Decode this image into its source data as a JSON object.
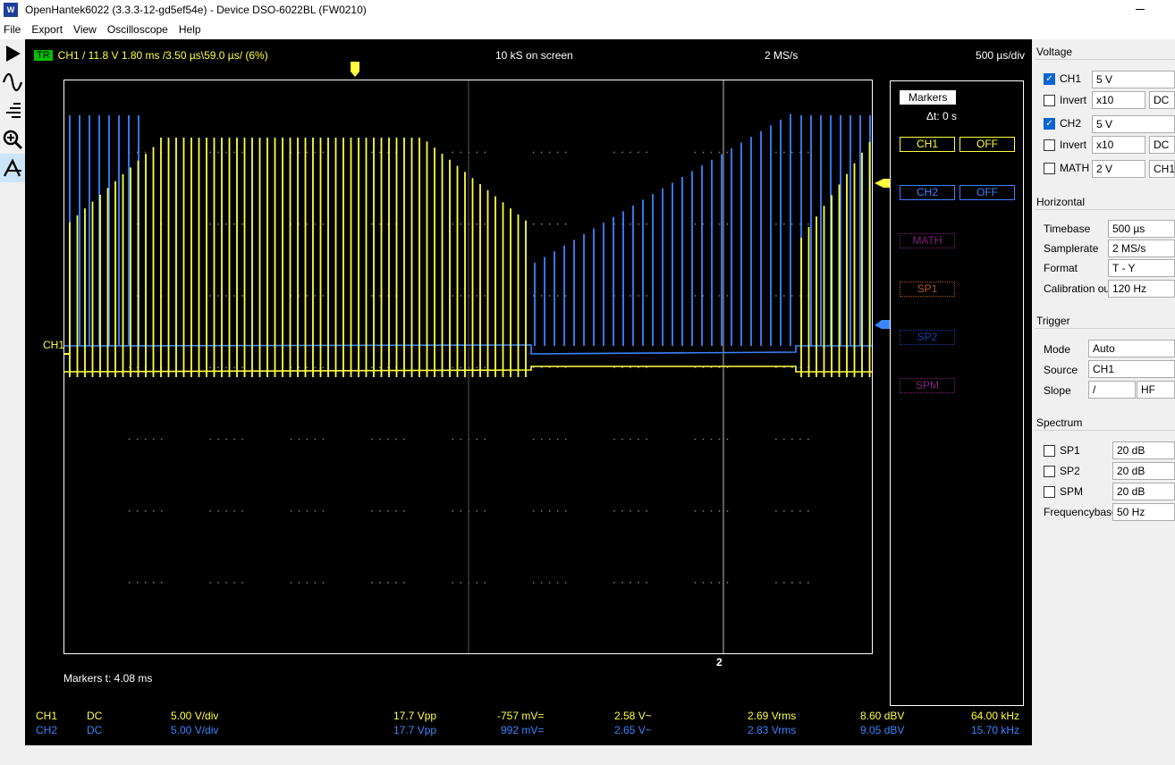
{
  "window": {
    "title": "OpenHantek6022 (3.3.3-12-gd5ef54e) - Device DSO-6022BL (FW0210)"
  },
  "menu": {
    "items": [
      "File",
      "Export",
      "View",
      "Oscilloscope",
      "Help"
    ]
  },
  "toolbar": {
    "icons": [
      "play-icon",
      "sine-icon",
      "histogram-icon",
      "zoom-icon",
      "cursor-measure-icon"
    ]
  },
  "scope": {
    "trigger_badge": "TR",
    "trigger_info": "CH1  /  11.8 V  1.80 ms  /3.50 µs\\59.0 µs/ (6%)",
    "samples_on_screen": "10 kS on screen",
    "samplerate": "2 MS/s",
    "timebase": "500 µs/div",
    "ch1_level_label": "CH1",
    "marker2_label": "2",
    "markers_readout": "Markers   t: 4.08 ms"
  },
  "markers_panel": {
    "title": "Markers",
    "delta_t": "Δt: 0 s",
    "buttons": [
      {
        "name": "CH1",
        "state": "OFF"
      },
      {
        "name": "CH2",
        "state": "OFF"
      },
      {
        "name": "MATH"
      },
      {
        "name": "SP1"
      },
      {
        "name": "SP2"
      },
      {
        "name": "SPM"
      }
    ]
  },
  "measurements": {
    "ch1": {
      "channel": "CH1",
      "coupling": "DC",
      "scale": "5.00 V/div",
      "vpp": "17.7 Vpp",
      "dc": "-757 mV=",
      "ac": "2.58 V~",
      "rms": "2.69 Vrms",
      "dbv": "8.60 dBV",
      "freq": "64.00 kHz"
    },
    "ch2": {
      "channel": "CH2",
      "coupling": "DC",
      "scale": "5.00 V/div",
      "vpp": "17.7 Vpp",
      "dc": "992 mV=",
      "ac": "2.65 V~",
      "rms": "2.83 Vrms",
      "dbv": "9.05 dBV",
      "freq": "15.70 kHz"
    }
  },
  "voltage": {
    "heading": "Voltage",
    "ch1": {
      "label": "CH1",
      "checked": true,
      "scale": "5 V",
      "invert_label": "Invert",
      "probe": "x10",
      "coupling": "DC"
    },
    "ch2": {
      "label": "CH2",
      "checked": true,
      "scale": "5 V",
      "invert_label": "Invert",
      "probe": "x10",
      "coupling": "DC"
    },
    "math": {
      "label": "MATH",
      "scale": "2 V",
      "mode": "CH1"
    }
  },
  "horizontal": {
    "heading": "Horizontal",
    "timebase_label": "Timebase",
    "timebase": "500 µs",
    "samplerate_label": "Samplerate",
    "samplerate": "2 MS/s",
    "format_label": "Format",
    "format": "T - Y",
    "calibration_label": "Calibration out",
    "calibration": "120 Hz"
  },
  "trigger": {
    "heading": "Trigger",
    "mode_label": "Mode",
    "mode": "Auto",
    "source_label": "Source",
    "source": "CH1",
    "slope_label": "Slope",
    "slope": "/",
    "filter": "HF"
  },
  "spectrum": {
    "heading": "Spectrum",
    "sp1": {
      "label": "SP1",
      "value": "20 dB"
    },
    "sp2": {
      "label": "SP2",
      "value": "20 dB"
    },
    "spm": {
      "label": "SPM",
      "value": "20 dB"
    },
    "freqbase_label": "Frequencybase",
    "freqbase": "50 Hz"
  },
  "colors": {
    "ch1": "#ffff40",
    "ch2": "#3a85ff",
    "math": "#80207a",
    "sp1": "#b05a20",
    "sp2": "#1a3fa8",
    "spm": "#80207a",
    "grid": "#808080"
  }
}
